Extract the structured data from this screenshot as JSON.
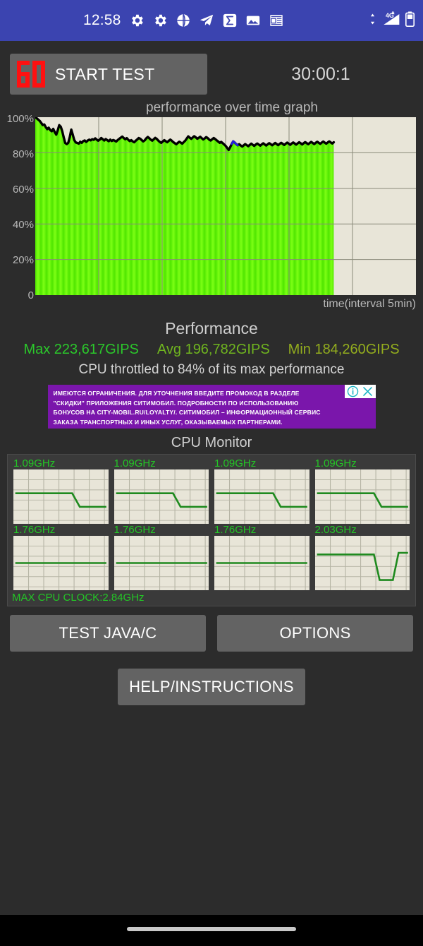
{
  "status_bar": {
    "background": "#3b44b0",
    "clock": "12:58",
    "icons": [
      "gear-icon",
      "gear-icon",
      "globe-icon",
      "telegram-icon",
      "sigma-icon",
      "photo-icon",
      "news-icon"
    ],
    "network_label": "4G",
    "right_icons": [
      "data-transfer-icon",
      "signal-4g-icon",
      "battery-icon"
    ]
  },
  "toolbar": {
    "logo_digits": "60",
    "logo_color": "#fe1111",
    "start_label": "START TEST",
    "timer": "30:00:1"
  },
  "chart_data": {
    "type": "area",
    "title": "performance over time graph",
    "xlabel": "time(interval 5min)",
    "ylabel": "",
    "ylim": [
      0,
      100
    ],
    "yticks": [
      "0",
      "20%",
      "40%",
      "60%",
      "80%",
      "100%"
    ],
    "ytick_values": [
      0,
      20,
      40,
      60,
      80,
      100
    ],
    "grid": true,
    "plot_background": "#e8e5d8",
    "fill_color": "#5cf000",
    "line_color": "#000000",
    "highlight_color": "#2222dd",
    "data_fraction_filled": 0.784,
    "series": [
      {
        "name": "performance %",
        "values": [
          100,
          99.4,
          98.6,
          97.9,
          96.8,
          95.6,
          95.9,
          94.4,
          93.3,
          94.1,
          92.7,
          92.1,
          93.4,
          91.6,
          90.2,
          92.6,
          95.5,
          94.6,
          92.1,
          88.6,
          85.5,
          84.9,
          85.6,
          88.7,
          93.0,
          90.2,
          87.2,
          85.8,
          85.5,
          85.1,
          86.2,
          85.6,
          86.6,
          86.9,
          86.1,
          86.9,
          87.4,
          87.0,
          87.6,
          87.3,
          88.1,
          87.4,
          86.8,
          87.4,
          88.3,
          87.6,
          86.9,
          87.7,
          87.1,
          86.5,
          87.4,
          86.6,
          87.2,
          86.8,
          86.3,
          87.2,
          87.8,
          88.5,
          89.1,
          88.3,
          87.6,
          88.2,
          87.3,
          86.6,
          87.1,
          86.4,
          85.9,
          86.8,
          87.5,
          88.3,
          87.9,
          87.1,
          86.4,
          87.0,
          88.1,
          88.9,
          88.2,
          87.4,
          86.8,
          87.6,
          88.4,
          87.8,
          86.9,
          86.1,
          85.6,
          86.3,
          87.1,
          86.5,
          85.9,
          86.7,
          87.4,
          86.8,
          86.0,
          85.4,
          84.8,
          85.5,
          86.2,
          85.7,
          85.1,
          86.0,
          86.8,
          88.0,
          89.2,
          88.5,
          87.8,
          88.6,
          89.3,
          88.7,
          87.9,
          88.4,
          89.0,
          88.2,
          87.5,
          88.1,
          88.8,
          88.2,
          87.4,
          86.9,
          87.6,
          88.3,
          87.7,
          87.0,
          86.3,
          85.6,
          86.1,
          85.4,
          84.6,
          83.8,
          82.7,
          81.6,
          83.2,
          85.0,
          86.4,
          85.7,
          84.9,
          84.2,
          84.8,
          84.1,
          83.5,
          84.2,
          84.9,
          84.3,
          83.7,
          84.4,
          85.1,
          84.5,
          83.9,
          84.6,
          85.2,
          84.6,
          84.0,
          84.7,
          85.3,
          84.7,
          84.1,
          84.8,
          85.4,
          84.8,
          84.2,
          84.9,
          85.5,
          84.9,
          84.3,
          85.0,
          85.6,
          85.0,
          84.4,
          85.1,
          85.7,
          85.1,
          84.5,
          85.2,
          85.8,
          85.2,
          84.6,
          85.3,
          85.9,
          85.3,
          84.7,
          85.4,
          86.0,
          85.4,
          84.8,
          85.5,
          86.1,
          85.5,
          84.9,
          85.6,
          86.2,
          85.6,
          85.0,
          85.7,
          86.3,
          85.7,
          85.1,
          85.8,
          86.4,
          85.8,
          85.2,
          85.9
        ]
      }
    ]
  },
  "performance": {
    "heading": "Performance",
    "max_label": "Max 223,617GIPS",
    "max_color": "#2bc72b",
    "avg_label": "Avg 196,782GIPS",
    "avg_color": "#6fb41f",
    "min_label": "Min 184,260GIPS",
    "min_color": "#93ad1e",
    "throttle_text": "CPU throttled to 84% of its max performance"
  },
  "ad": {
    "background": "#7a16ab",
    "line1": "ИМЕЮТСЯ ОГРАНИЧЕНИЯ. ДЛЯ УТОЧНЕНИЯ ВВЕДИТЕ ПРОМОКОД В РАЗДЕЛЕ",
    "line2": "\"СКИДКИ\" ПРИЛОЖЕНИЯ СИТИМОБИЛ. ПОДРОБНОСТИ ПО ИСПОЛЬЗОВАНИЮ",
    "line3": "БОНУСОВ НА CITY-MOBIL.RU/LOYALTY/. СИТИМОБИЛ – ИНФОРМАЦИОННЫЙ СЕРВИС",
    "line4": "ЗАКАЗА ТРАНСПОРТНЫХ И ИНЫХ УСЛУГ, ОКАЗЫВАЕМЫХ ПАРТНЕРАМИ.",
    "info_icon": "info-circle-icon",
    "close_icon": "close-x-icon",
    "badge_color": "#18b2c4"
  },
  "cpu_monitor": {
    "title": "CPU Monitor",
    "line_color": "#1f8a1f",
    "cells": [
      {
        "freq": "1.09GHz",
        "shape": "step-down-late"
      },
      {
        "freq": "1.09GHz",
        "shape": "step-down-late"
      },
      {
        "freq": "1.09GHz",
        "shape": "step-down-late"
      },
      {
        "freq": "1.09GHz",
        "shape": "step-down-late"
      },
      {
        "freq": "1.76GHz",
        "shape": "flat"
      },
      {
        "freq": "1.76GHz",
        "shape": "flat"
      },
      {
        "freq": "1.76GHz",
        "shape": "flat"
      },
      {
        "freq": "2.03GHz",
        "shape": "dip-recover"
      }
    ],
    "max_clock": "MAX CPU CLOCK:2.84GHz"
  },
  "buttons": {
    "test_java_c": "TEST JAVA/C",
    "options": "OPTIONS",
    "help": "HELP/INSTRUCTIONS"
  },
  "nav_bar": {
    "gesture_pill": "home-gesture-pill"
  }
}
